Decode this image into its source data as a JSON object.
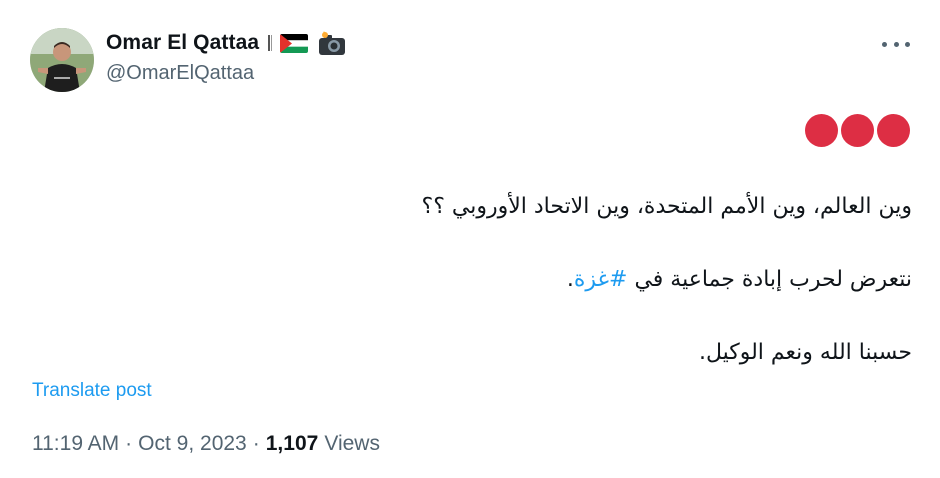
{
  "user": {
    "display_name": "Omar El Qattaa",
    "handle": "@OmarElQattaa",
    "badges": [
      "palestine-flag-icon",
      "camera-flash-icon"
    ]
  },
  "post": {
    "emoji_row": [
      "red-circle",
      "red-circle",
      "red-circle"
    ],
    "line1": "وين العالم، وين الأمم المتحدة، وين الاتحاد الأوروبي ؟؟",
    "line2_prefix": "نتعرض لحرب إبادة جماعية في ",
    "line2_hashtag": "#غزة",
    "line2_suffix": ".",
    "line3": "حسبنا الله ونعم الوكيل."
  },
  "actions": {
    "translate_label": "Translate post",
    "more_icon": "more-horizontal-icon"
  },
  "meta": {
    "time": "11:19 AM",
    "separator": "·",
    "date": "Oct 9, 2023",
    "views_count": "1,107",
    "views_label": "Views"
  },
  "colors": {
    "link": "#1d9bf0",
    "secondary_text": "#536471",
    "primary_text": "#0f1419",
    "red_circle": "#dd2e44"
  }
}
